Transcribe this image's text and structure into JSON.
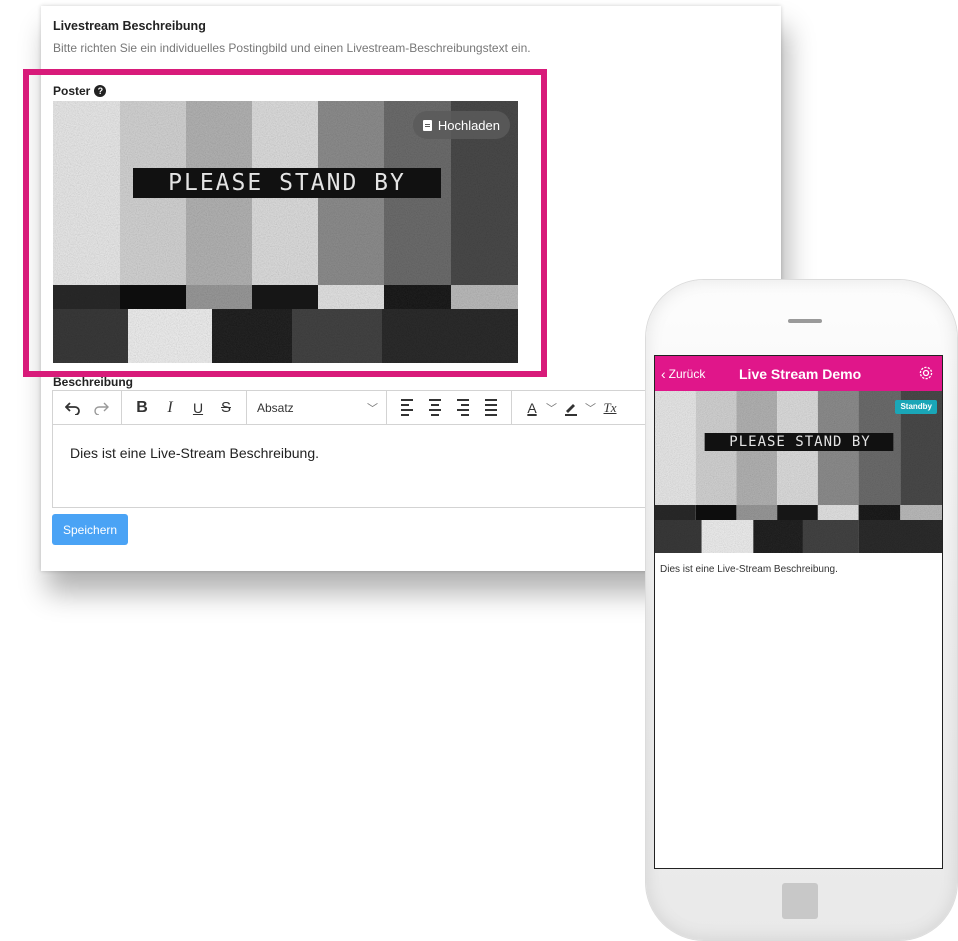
{
  "section": {
    "title": "Livestream Beschreibung",
    "subtitle": "Bitte richten Sie ein individuelles Postingbild und einen Livestream-Beschreibungstext ein."
  },
  "poster": {
    "label": "Poster",
    "help_icon": "question-circle-icon",
    "upload_label": "Hochladen",
    "upload_icon": "file-icon",
    "overlay_text": "PLEASE STAND BY",
    "highlight_color": "#d81b7a"
  },
  "description": {
    "label": "Beschreibung",
    "toolbar": {
      "undo_icon": "undo-icon",
      "redo_icon": "redo-icon",
      "bold": "B",
      "italic": "I",
      "underline": "U",
      "strikethrough": "S",
      "format_value": "Absatz",
      "text_color": "A",
      "clear_format": "Tx"
    },
    "content": "Dies ist eine Live-Stream Beschreibung."
  },
  "save_label": "Speichern",
  "phone": {
    "back_label": "Zurück",
    "title": "Live Stream Demo",
    "badge": "Standby",
    "overlay_text": "PLEASE STAND BY",
    "description": "Dies ist eine Live-Stream Beschreibung.",
    "header_color": "#e0168a",
    "badge_color": "#1aa6b7"
  }
}
